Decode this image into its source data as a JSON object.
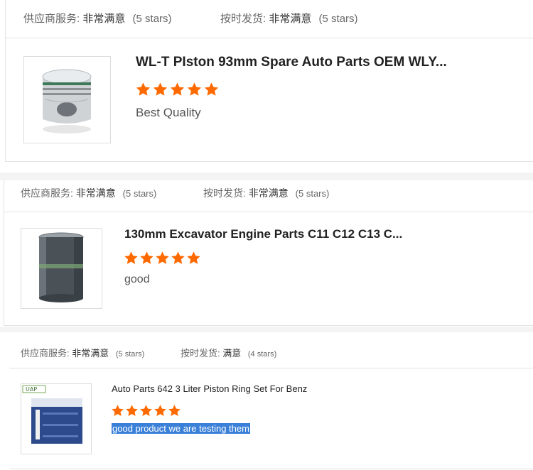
{
  "reviews": [
    {
      "supplier_label": "供应商服务:",
      "supplier_value": "非常满意",
      "supplier_stars": "(5 stars)",
      "delivery_label": "按时发货:",
      "delivery_value": "非常满意",
      "delivery_stars": "(5 stars)",
      "title": "WL-T PIston 93mm Spare Auto Parts OEM WLY...",
      "rating": 5,
      "comment": "Best Quality",
      "image_icon": "piston-product-image"
    },
    {
      "supplier_label": "供应商服务:",
      "supplier_value": "非常满意",
      "supplier_stars": "(5 stars)",
      "delivery_label": "按时发货:",
      "delivery_value": "非常满意",
      "delivery_stars": "(5 stars)",
      "title": "130mm Excavator Engine Parts C11 C12 C13 C...",
      "rating": 5,
      "comment": "good",
      "image_icon": "cylinder-liner-product-image"
    },
    {
      "supplier_label": "供应商服务:",
      "supplier_value": "非常满意",
      "supplier_stars": "(5 stars)",
      "delivery_label": "按时发货:",
      "delivery_value": "满意",
      "delivery_stars": "(4 stars)",
      "title": "Auto Parts 642 3 Liter Piston Ring Set For Benz",
      "rating": 5,
      "comment": "good product we are testing them",
      "image_icon": "piston-ring-box-product-image",
      "box_brand": "UAP"
    }
  ],
  "colors": {
    "star": "#ff6a00",
    "selection": "#3a80d8"
  }
}
